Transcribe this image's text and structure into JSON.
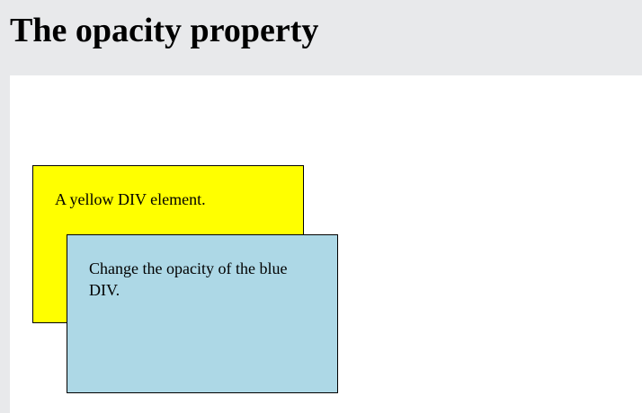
{
  "page": {
    "title": "The opacity property"
  },
  "demo": {
    "yellow_box_text": "A yellow DIV element.",
    "blue_box_text": "Change the opacity of the blue DIV.",
    "blue_box_opacity": 1,
    "colors": {
      "page_background": "#e8e9eb",
      "demo_background": "#ffffff",
      "yellow_box": "#ffff00",
      "blue_box": "#add8e6",
      "border": "#000000"
    }
  }
}
